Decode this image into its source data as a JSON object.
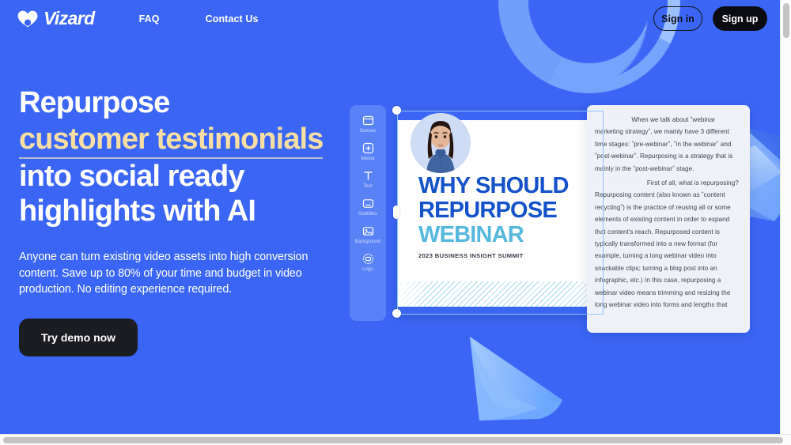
{
  "brand": {
    "name": "Vizard",
    "logo_icon": "heart-shield-icon",
    "primary_color": "#3b66f5",
    "accent_color": "#f7dfa4",
    "dark_color": "#0a0c11"
  },
  "nav": {
    "links": [
      {
        "label": "FAQ",
        "name": "nav-link-faq"
      },
      {
        "label": "Contact Us",
        "name": "nav-link-contact"
      }
    ],
    "sign_in": "Sign in",
    "sign_up": "Sign up"
  },
  "hero": {
    "headline_line1": "Repurpose",
    "headline_accent": "customer testimonials",
    "headline_line3": "into social ready",
    "headline_line4": "highlights with AI",
    "subcopy": "Anyone can turn existing video assets into high conversion content. Save up to 80% of your time and budget in video production. No editing experience required.",
    "cta_label": "Try demo now"
  },
  "editor": {
    "tools": [
      {
        "label": "Scenes",
        "icon": "scenes-icon"
      },
      {
        "label": "Media",
        "icon": "media-plus-icon"
      },
      {
        "label": "Text",
        "icon": "text-icon"
      },
      {
        "label": "Subtitles",
        "icon": "subtitles-icon"
      },
      {
        "label": "Background",
        "icon": "background-image-icon"
      },
      {
        "label": "Logo",
        "icon": "logo-badge-icon"
      }
    ],
    "slide": {
      "title_line1": "WHY SHOULD",
      "title_line2": "REPURPOSE",
      "title_line3": "WEBINAR",
      "subtitle": "2023 BUSINESS INSIGHT SUMMIT",
      "presenter_alt": "presenter-avatar"
    },
    "transcript": {
      "paragraph1_lead": "· · · · ·",
      "paragraph1": "When we talk about ˮwebinar marketing strategyˮ, we mainly have 3 different time stages: ˮpre-webinarˮ, ˮin the webinarˮ and ˮpost-webinarˮ. Repurposing is a strategy that is mainly in the ˮpost-webinarˮ stage.",
      "paragraph2_lead": "· · · · · · ·",
      "paragraph2": "First of all, what is repurposing? Repurposing content (also known as ˮcontent recyclingˮ) is the practice of reusing all or some elements of existing content in order to expand that content's reach. Repurposed content is typically transformed into a new format (for example, turning a long webinar video into snackable clips; turning a blog post into an infographic, etc.) In this case, repurposing a webinar video means trimming and resizing the long webinar video into forms and lengths that"
    }
  },
  "decoration": {
    "torus": "torus-shape",
    "gem": "polyhedron-gem-shape",
    "cone": "cone-play-shape"
  },
  "scrollbars": {
    "vertical": "vertical-scrollbar",
    "horizontal": "horizontal-scrollbar"
  }
}
